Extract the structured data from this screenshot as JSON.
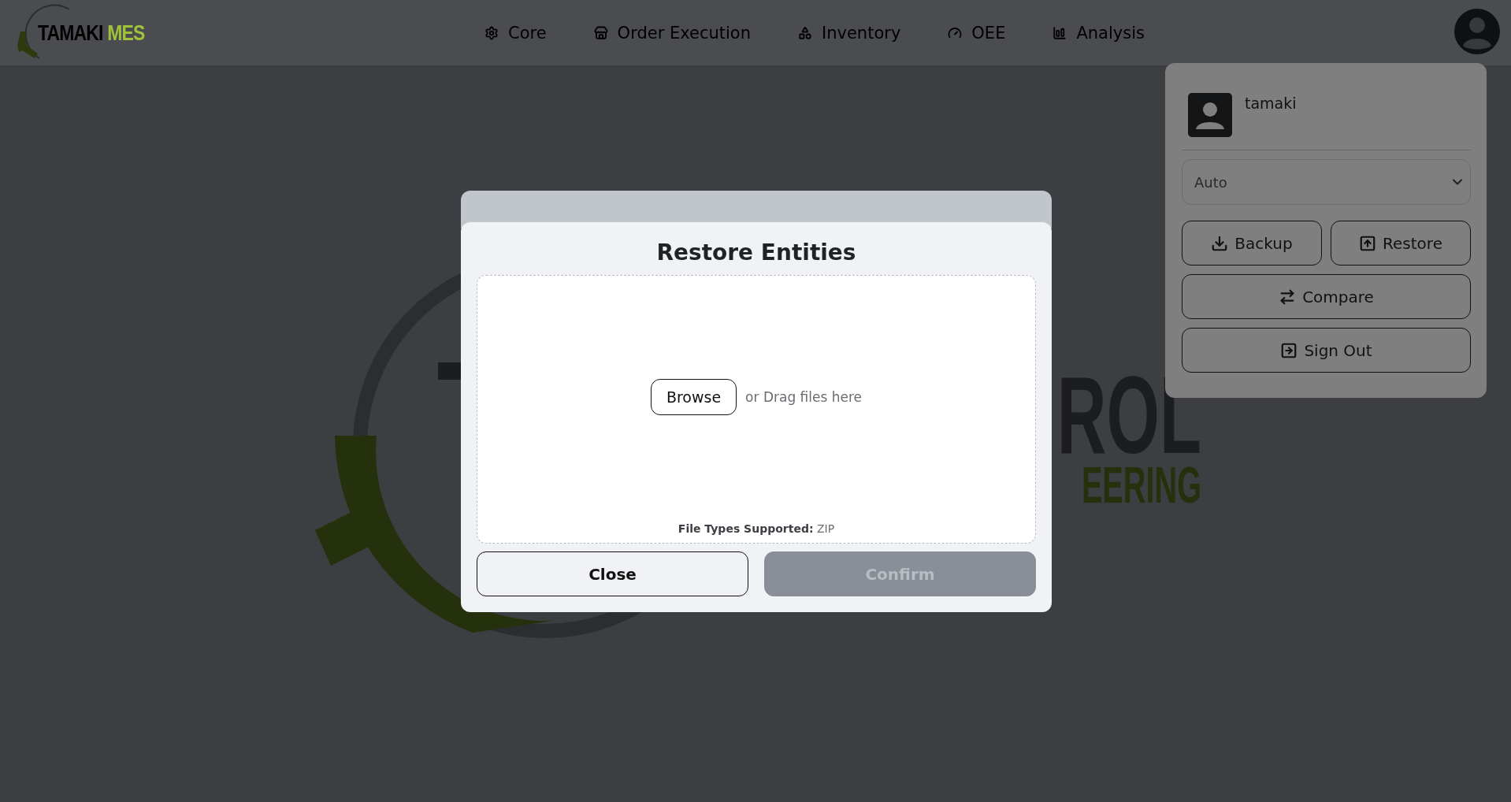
{
  "header": {
    "logo": {
      "name": "TAMAKI",
      "suffix": "MES"
    },
    "nav": [
      {
        "label": "Core"
      },
      {
        "label": "Order Execution"
      },
      {
        "label": "Inventory"
      },
      {
        "label": "OEE"
      },
      {
        "label": "Analysis"
      }
    ]
  },
  "background_logo": {
    "line_1_right": "ROL",
    "line_2_right": "EERING"
  },
  "user_menu": {
    "username": "tamaki",
    "theme_select": {
      "value": "Auto"
    },
    "buttons": [
      {
        "label": "Backup"
      },
      {
        "label": "Restore"
      },
      {
        "label": "Compare"
      },
      {
        "label": "Sign Out"
      }
    ]
  },
  "dialog": {
    "title": "Restore Entities",
    "dropzone": {
      "browse": "Browse",
      "hint": "or Drag files here",
      "supported": "**File Types Supported:** ZIP"
    },
    "buttons": [
      {
        "label": "Close",
        "disabled": false
      },
      {
        "label": "Confirm",
        "disabled": true
      }
    ]
  }
}
